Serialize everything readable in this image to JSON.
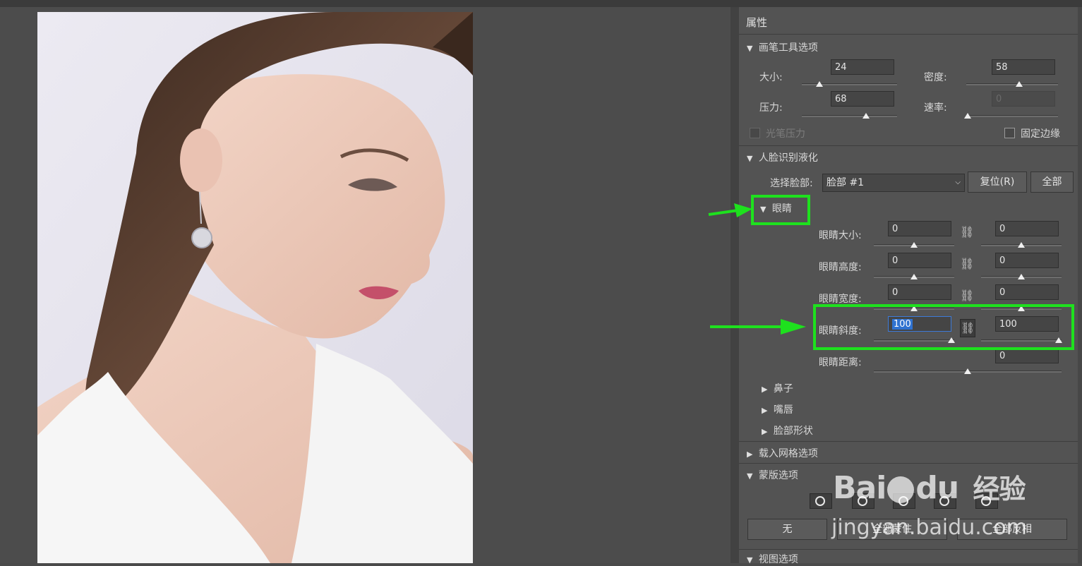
{
  "panel": {
    "title": "属性",
    "brush": {
      "header": "画笔工具选项",
      "size_label": "大小:",
      "size_value": "24",
      "size_level": 0.13,
      "density_label": "密度:",
      "density_value": "58",
      "density_level": 0.58,
      "pressure_label": "压力:",
      "pressure_value": "68",
      "pressure_level": 0.68,
      "rate_label": "速率:",
      "rate_value": "0",
      "rate_level": 0.0,
      "stylus_label": "光笔压力",
      "pin_edges_label": "固定边缘"
    },
    "face": {
      "header": "人脸识别液化",
      "select_label": "选择脸部:",
      "select_value": "脸部 #1",
      "reset_label": "复位(R)",
      "all_label": "全部",
      "eyes": {
        "header": "眼睛",
        "rows": [
          {
            "label": "眼睛大小:",
            "left": "0",
            "right": "0"
          },
          {
            "label": "眼睛高度:",
            "left": "0",
            "right": "0"
          },
          {
            "label": "眼睛宽度:",
            "left": "0",
            "right": "0"
          },
          {
            "label": "眼睛斜度:",
            "left": "100",
            "right": "100"
          }
        ],
        "distance_label": "眼睛距离:",
        "distance_value": "0"
      },
      "nose": "鼻子",
      "mouth": "嘴唇",
      "face_shape": "脸部形状"
    },
    "mesh": {
      "header": "载入网格选项"
    },
    "mask": {
      "header": "蒙版选项",
      "none_label": "无",
      "mask_all_label": "全部蒙住",
      "invert_all_label": "全部反相"
    },
    "view": {
      "header": "视图选项"
    }
  },
  "watermark": {
    "brand": "Bai",
    "brand2": "du",
    "brand_cn": "经验",
    "url": "jingyan.baidu.com"
  },
  "colors": {
    "highlight": "#1ee11e",
    "panel_bg": "#535353",
    "canvas_bg": "#4c4c4c"
  }
}
